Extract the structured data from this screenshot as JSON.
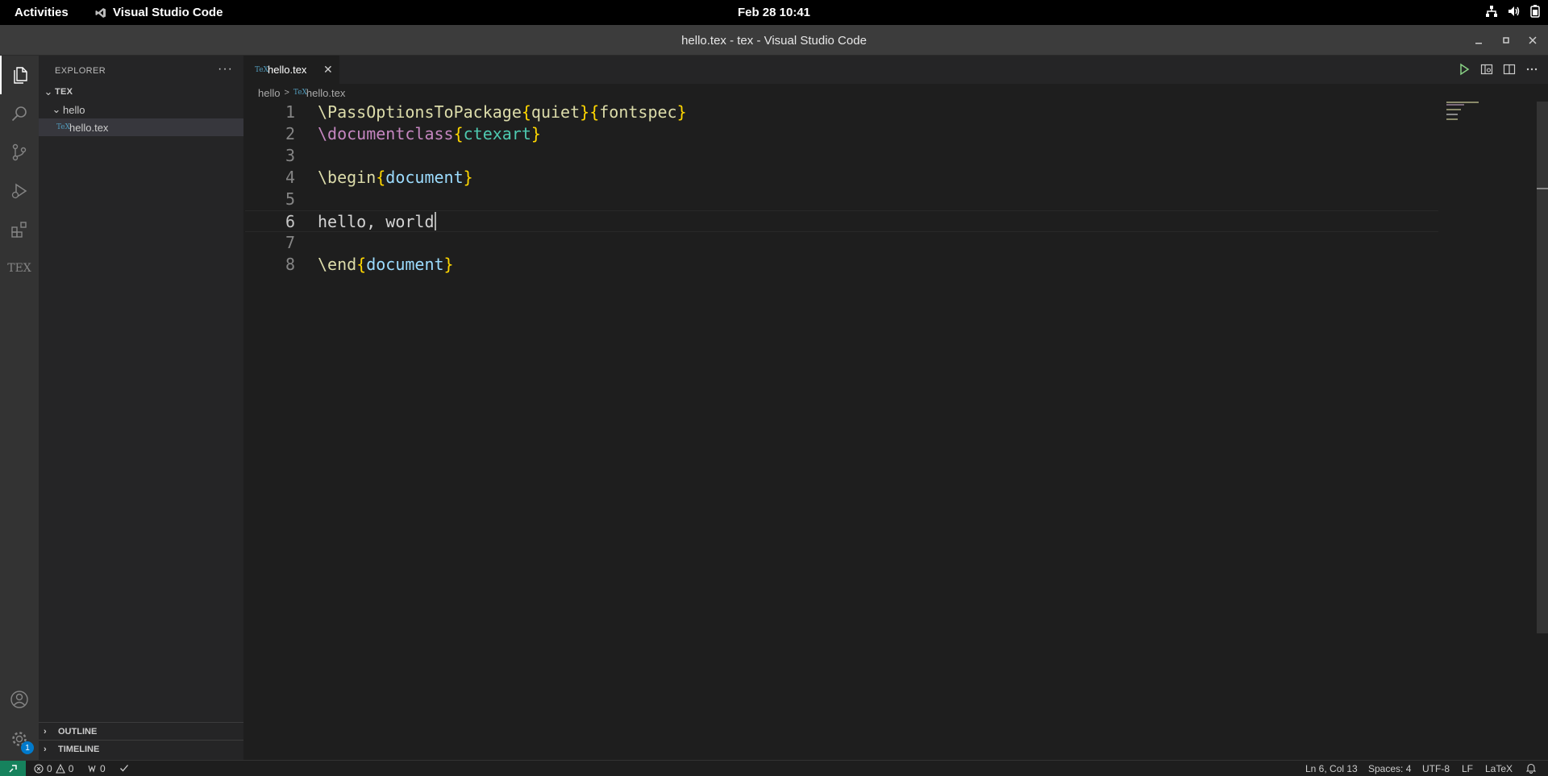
{
  "topbar": {
    "activities": "Activities",
    "app_name": "Visual Studio Code",
    "clock": "Feb 28  10:41"
  },
  "window": {
    "title": "hello.tex - tex - Visual Studio Code"
  },
  "activity_bar": {
    "items": [
      "explorer-icon",
      "search-icon",
      "source-control-icon",
      "run-debug-icon",
      "extensions-icon",
      "tex-icon"
    ],
    "bottom": [
      "accounts-icon",
      "manage-gear-icon"
    ],
    "manage_badge": "1",
    "tex_label": "TEX"
  },
  "sidebar": {
    "header": "EXPLORER",
    "more": "···",
    "root": "TEX",
    "folder": "hello",
    "file": "hello.tex",
    "file_icon": "TeX",
    "outline": "OUTLINE",
    "timeline": "TIMELINE"
  },
  "editor": {
    "tab_label": "hello.tex",
    "tab_icon": "TeX",
    "breadcrumb_folder": "hello",
    "breadcrumb_sep": ">",
    "breadcrumb_file": "hello.tex",
    "cursor_line": 6,
    "lines": [
      {
        "n": "1",
        "parts": [
          [
            "cmd-y",
            "\\PassOptionsToPackage"
          ],
          [
            "br",
            "{"
          ],
          [
            "cmd-y",
            "quiet"
          ],
          [
            "br",
            "}"
          ],
          [
            "br",
            "{"
          ],
          [
            "cmd-y",
            "fontspec"
          ],
          [
            "br",
            "}"
          ]
        ]
      },
      {
        "n": "2",
        "parts": [
          [
            "cmd",
            "\\documentclass"
          ],
          [
            "br",
            "{"
          ],
          [
            "argc",
            "ctexart"
          ],
          [
            "br",
            "}"
          ]
        ]
      },
      {
        "n": "3",
        "parts": []
      },
      {
        "n": "4",
        "parts": [
          [
            "cmd-y",
            "\\begin"
          ],
          [
            "br",
            "{"
          ],
          [
            "arg",
            "document"
          ],
          [
            "br",
            "}"
          ]
        ]
      },
      {
        "n": "5",
        "parts": []
      },
      {
        "n": "6",
        "parts": [
          [
            "plain",
            "hello, world"
          ]
        ]
      },
      {
        "n": "7",
        "parts": []
      },
      {
        "n": "8",
        "parts": [
          [
            "cmd-y",
            "\\end"
          ],
          [
            "br",
            "{"
          ],
          [
            "arg",
            "document"
          ],
          [
            "br",
            "}"
          ]
        ]
      }
    ]
  },
  "statusbar": {
    "errors": "0",
    "warnings": "0",
    "ports": "0",
    "position": "Ln 6, Col 13",
    "spaces": "Spaces: 4",
    "encoding": "UTF-8",
    "eol": "LF",
    "language": "LaTeX"
  },
  "colors": {
    "accent": "#007acc",
    "remote": "#16825d",
    "bracket": "#ffd700"
  }
}
